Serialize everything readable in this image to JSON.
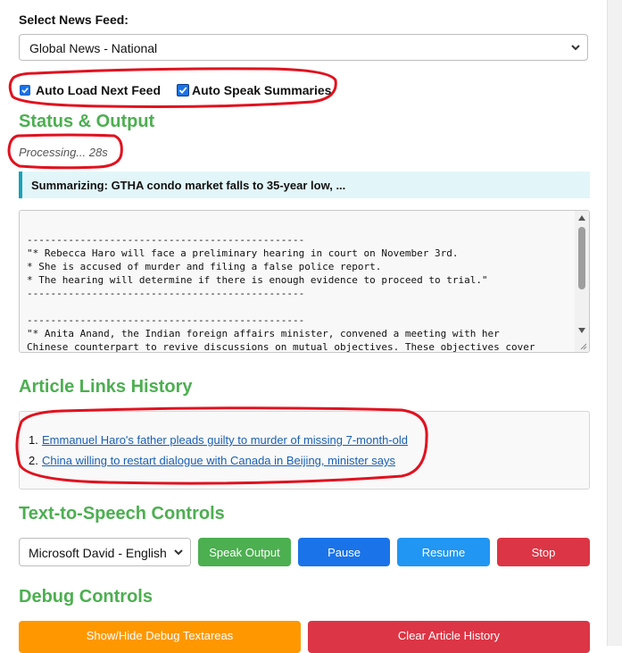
{
  "feed": {
    "label": "Select News Feed:",
    "selected": "Global News - National"
  },
  "options": {
    "auto_load_label": "Auto Load Next Feed",
    "auto_speak_label": "Auto Speak Summaries",
    "auto_load_checked": true,
    "auto_speak_checked": true
  },
  "status": {
    "title": "Status & Output",
    "processing": "Processing... 28s",
    "summarizing": "Summarizing: GTHA condo market falls to 35-year low, ..."
  },
  "output": {
    "lines": [
      "-----------------------------------------------",
      "\"* Rebecca Haro will face a preliminary hearing in court on November 3rd.",
      "* She is accused of murder and filing a false police report.",
      "* The hearing will determine if there is enough evidence to proceed to trial.\"",
      "-----------------------------------------------",
      "",
      "-----------------------------------------------",
      "\"* Anita Anand, the Indian foreign affairs minister, convened a meeting with her",
      "Chinese counterpart to revive discussions on mutual objectives. These objectives cover"
    ]
  },
  "history": {
    "title": "Article Links History",
    "items": [
      {
        "num": "1.",
        "text": "Emmanuel Haro's father pleads guilty to murder of missing 7-month-old"
      },
      {
        "num": "2.",
        "text": "China willing to restart dialogue with Canada in Beijing, minister says"
      }
    ]
  },
  "tts": {
    "title": "Text-to-Speech Controls",
    "voice": "Microsoft David - English (United States)",
    "speak_label": "Speak Output",
    "pause_label": "Pause",
    "resume_label": "Resume",
    "stop_label": "Stop"
  },
  "debug": {
    "title": "Debug Controls",
    "toggle_label": "Show/Hide Debug Textareas",
    "clear_label": "Clear Article History"
  },
  "colors": {
    "section_title": "#4caf50",
    "annotation": "#e0121f",
    "speak": "#4caf50",
    "pause": "#1a73e8",
    "resume": "#2196f3",
    "stop": "#dc3545",
    "debug": "#ff9800"
  },
  "icons": [
    "chevron-down-icon",
    "checkbox-checked-icon",
    "resize-grip-icon",
    "scroll-up-arrow-icon",
    "scroll-down-arrow-icon"
  ]
}
